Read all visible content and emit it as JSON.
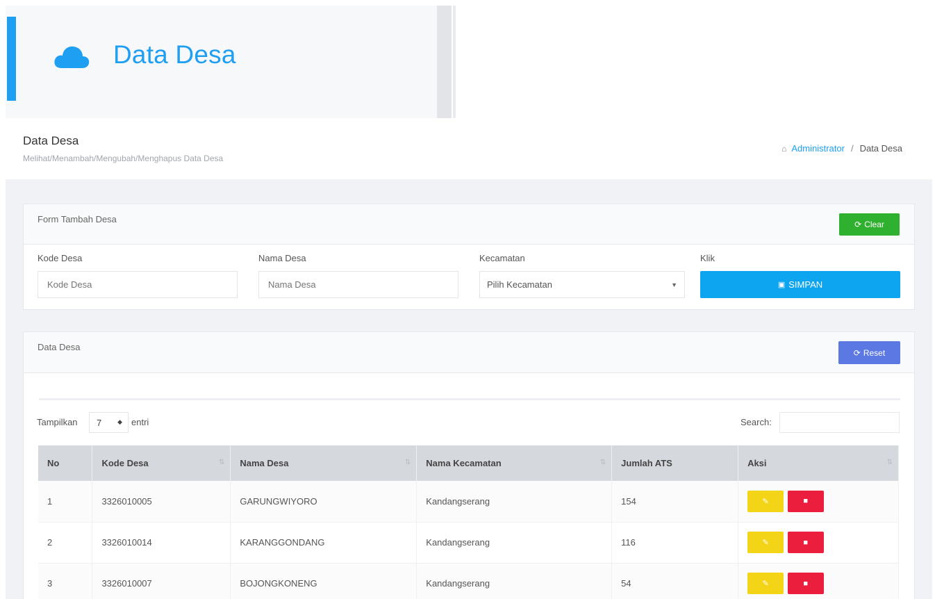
{
  "banner": {
    "icon": "cloud-icon",
    "title": "Data Desa",
    "accent_color": "#1e9ff2"
  },
  "header": {
    "title": "Data Desa",
    "subtitle": "Melihat/Menambah/Mengubah/Menghapus Data Desa",
    "breadcrumb": {
      "home_icon": "home-icon",
      "link": "Administrator",
      "separator": "/",
      "current": "Data Desa"
    }
  },
  "form_card": {
    "title": "Form Tambah Desa",
    "clear_button": "Clear",
    "clear_icon": "refresh-icon",
    "fields": {
      "kode": {
        "label": "Kode Desa",
        "placeholder": "Kode Desa",
        "value": ""
      },
      "nama": {
        "label": "Nama Desa",
        "placeholder": "Nama Desa",
        "value": ""
      },
      "kecamatan": {
        "label": "Kecamatan",
        "selected": "Pilih Kecamatan"
      },
      "klik": {
        "label": "Klik"
      }
    },
    "save_button": "SIMPAN",
    "save_icon": "floppy-disk-icon"
  },
  "table_card": {
    "title": "Data Desa",
    "reset_button": "Reset",
    "reset_icon": "refresh-icon",
    "length_label_before": "Tampilkan",
    "length_value": "7",
    "length_label_after": "entri",
    "search_label": "Search:",
    "search_value": "",
    "columns": [
      "No",
      "Kode Desa",
      "Nama Desa",
      "Nama Kecamatan",
      "Jumlah ATS",
      "Aksi"
    ],
    "rows": [
      {
        "no": "1",
        "kode": "3326010005",
        "nama": "GARUNGWIYORO",
        "kecamatan": "Kandangserang",
        "jumlah": "154"
      },
      {
        "no": "2",
        "kode": "3326010014",
        "nama": "KARANGGONDANG",
        "kecamatan": "Kandangserang",
        "jumlah": "116"
      },
      {
        "no": "3",
        "kode": "3326010007",
        "nama": "BOJONGKONENG",
        "kecamatan": "Kandangserang",
        "jumlah": "54"
      }
    ],
    "edit_icon": "edit-icon",
    "delete_icon": "trash-icon",
    "colors": {
      "edit": "#f4d416",
      "delete": "#ec1e3d",
      "header_bg": "#d5d8dd"
    }
  }
}
